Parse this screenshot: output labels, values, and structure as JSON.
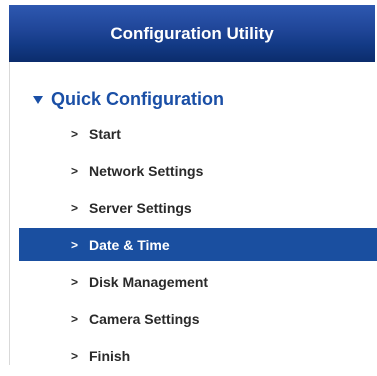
{
  "header": {
    "title": "Configuration Utility"
  },
  "section": {
    "title": "Quick Configuration",
    "icon": "triangle-down-icon"
  },
  "menu": {
    "arrow_glyph": ">",
    "active_color": "#1a4fa0",
    "items": [
      {
        "label": "Start",
        "active": false
      },
      {
        "label": "Network Settings",
        "active": false
      },
      {
        "label": "Server Settings",
        "active": false
      },
      {
        "label": "Date & Time",
        "active": true
      },
      {
        "label": "Disk Management",
        "active": false
      },
      {
        "label": "Camera Settings",
        "active": false
      },
      {
        "label": "Finish",
        "active": false
      }
    ]
  }
}
